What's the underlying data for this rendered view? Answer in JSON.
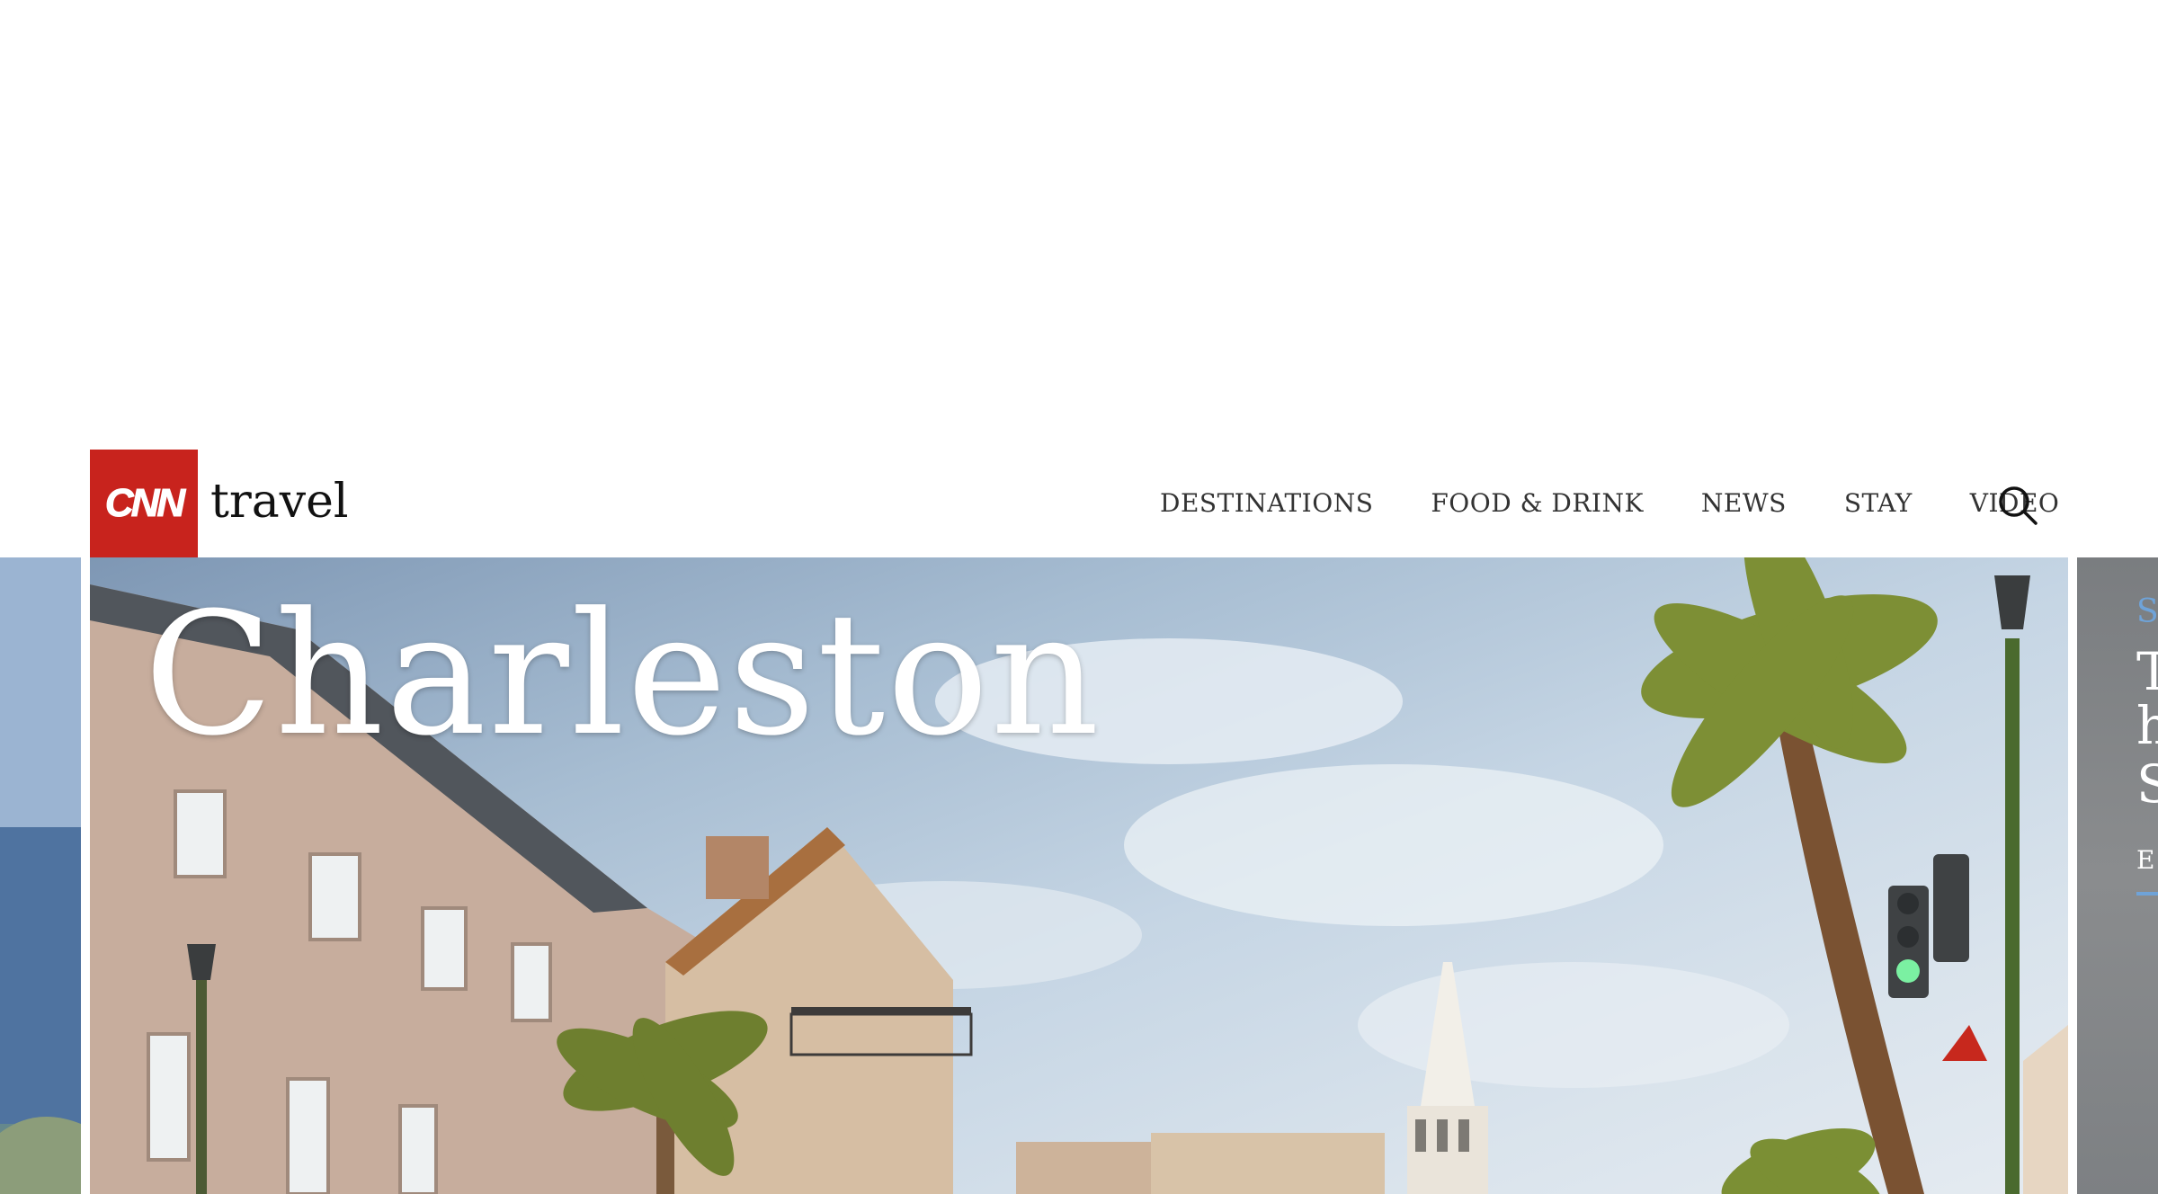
{
  "brand": {
    "logo_text": "CNN",
    "section": "travel",
    "logo_color": "#c8231d"
  },
  "nav": {
    "items": [
      {
        "label": "DESTINATIONS"
      },
      {
        "label": "FOOD & DRINK"
      },
      {
        "label": "NEWS"
      },
      {
        "label": "STAY"
      },
      {
        "label": "VIDEO"
      }
    ],
    "search_icon": "search-icon"
  },
  "hero": {
    "title": "Charleston"
  },
  "next_slide": {
    "kicker": "S",
    "lines": [
      "T",
      "h",
      "S"
    ],
    "explore": "E"
  },
  "colors": {
    "accent": "#6fa3d8"
  }
}
